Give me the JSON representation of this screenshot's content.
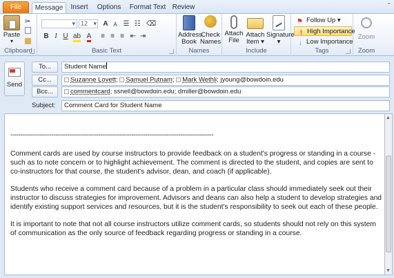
{
  "tabs": [
    "File",
    "Message",
    "Insert",
    "Options",
    "Format Text",
    "Review"
  ],
  "ribbon": {
    "clipboard": {
      "paste": "Paste",
      "label": "Clipboard"
    },
    "basic_text": {
      "font_size": "12",
      "label": "Basic Text"
    },
    "names": {
      "address_book": [
        "Address",
        "Book"
      ],
      "check_names": [
        "Check",
        "Names"
      ],
      "label": "Names"
    },
    "include": {
      "attach_file": [
        "Attach",
        "File"
      ],
      "attach_item": [
        "Attach",
        "Item ▾"
      ],
      "signature": [
        "Signature",
        "▾"
      ],
      "label": "Include"
    },
    "tags": {
      "follow_up": "Follow Up ▾",
      "high_importance": "High Importance",
      "low_importance": "Low Importance",
      "label": "Tags"
    },
    "zoom": {
      "zoom": "Zoom",
      "label": "Zoom"
    }
  },
  "header": {
    "send": "Send",
    "to_label": "To...",
    "to_value": "Student Name",
    "cc_label": "Cc...",
    "cc_recipients": [
      "Suzanne Lovett",
      "Samuel Putnam",
      "Mark Wethli"
    ],
    "cc_plain": "jyoung@bowdoin.edu",
    "bcc_label": "Bcc...",
    "bcc_recipient": "commentcard",
    "bcc_plain": "ssnell@bowdoin.edu; dmiller@bowdoin.edu",
    "subject_label": "Subject:",
    "subject_value": "Comment Card for Student Name"
  },
  "body": {
    "divider": "--------------------------------------------------------------------------------------------------------",
    "paragraphs": [
      "Comment cards are used by course instructors to provide feedback on a student's progress or standing in a course - such as to note concern or to highlight achievement.  The comment is directed to the student, and copies are sent to co-instructors for that course, the student's advisor, dean, and coach (if applicable).",
      "Students who receive a comment card because of a problem in a particular class should immediately seek out their instructor to discuss strategies for improvement.  Advisors and deans can also help a student to develop strategies and identify existing support services and resources, but it is the student's responsibility to seek out each of these people.",
      "It is important to note that not all course instructors utilize comment cards, so students should not rely on this system of communication as the only source of feedback regarding progress or standing in a course."
    ]
  },
  "colors": {
    "file_tab": "#e7760c",
    "ribbon_border": "#a3bad8",
    "high_importance": "#d83b3b",
    "low_importance": "#2f6fd0"
  }
}
